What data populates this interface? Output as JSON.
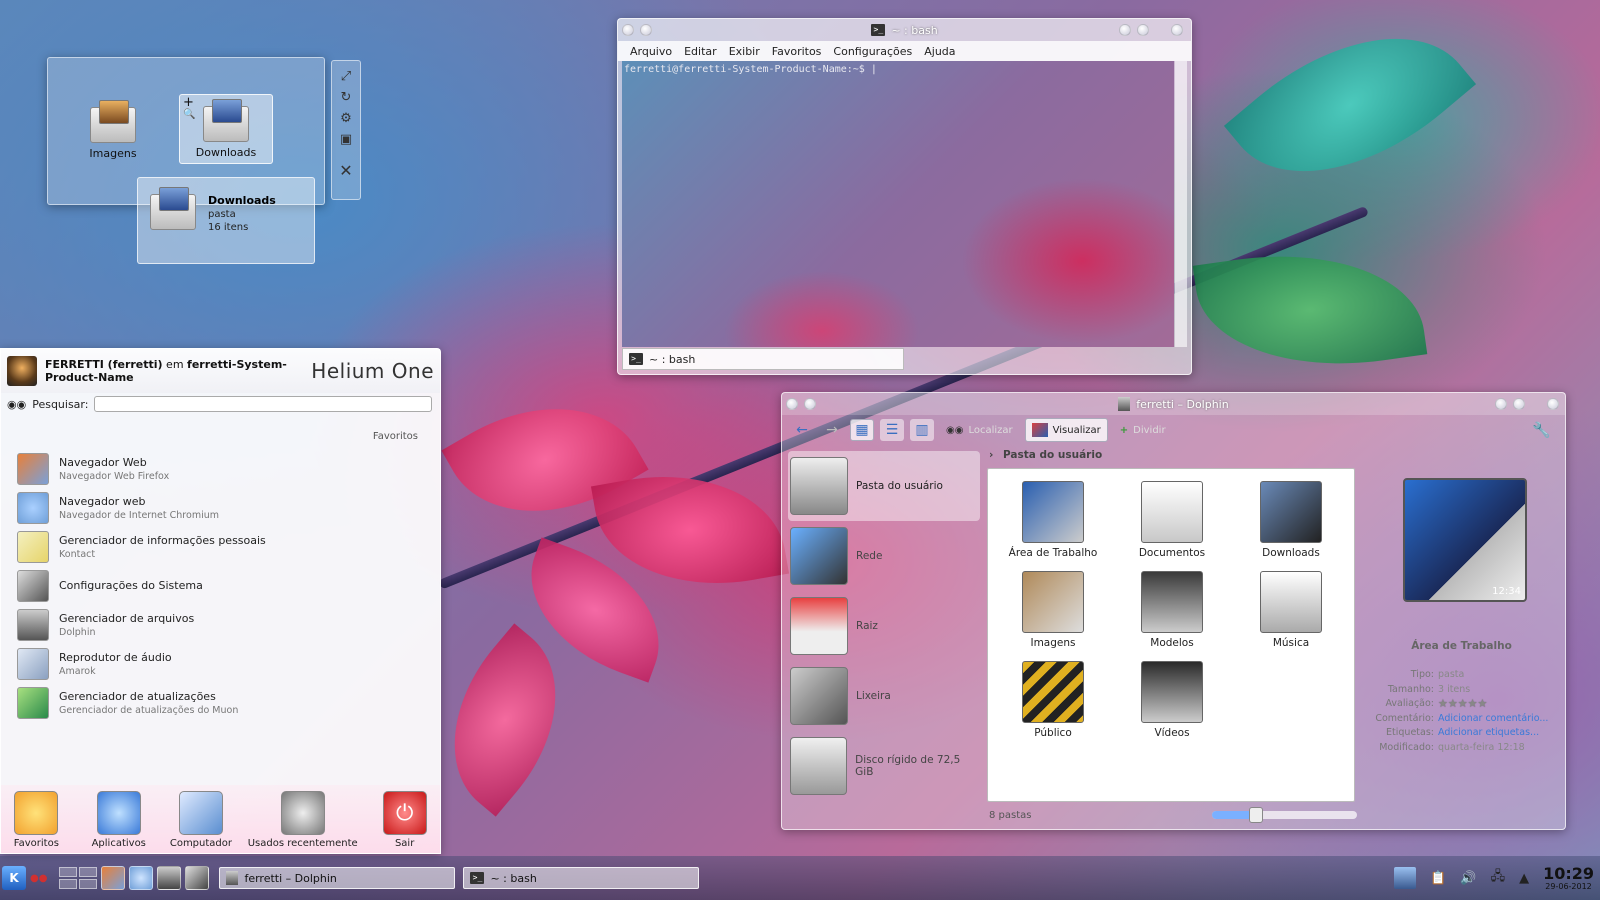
{
  "folderview": {
    "items": [
      {
        "label": "Imagens"
      },
      {
        "label": "Downloads"
      }
    ],
    "tooltip": {
      "name": "Downloads",
      "type": "pasta",
      "count": "16 itens"
    },
    "toolbar_icons": [
      "resize-icon",
      "rotate-icon",
      "settings-icon",
      "maximize-icon",
      "close-icon"
    ]
  },
  "terminal": {
    "title": "~ : bash",
    "menu": [
      "Arquivo",
      "Editar",
      "Exibir",
      "Favoritos",
      "Configurações",
      "Ajuda"
    ],
    "prompt": "ferretti@ferretti-System-Product-Name:~$ ",
    "tab_label": "~ : bash"
  },
  "launcher": {
    "user_name": "FERRETTI (ferretti)",
    "user_sep": " em ",
    "host": "ferretti-System-Product-Name",
    "brand": "Helium One",
    "search_label": "Pesquisar:",
    "search_value": "",
    "section_heading": "Favoritos",
    "apps": [
      {
        "name": "Navegador Web",
        "desc": "Navegador Web Firefox",
        "icon": "firefox-icon",
        "color": "#e8803a"
      },
      {
        "name": "Navegador web",
        "desc": "Navegador de Internet Chromium",
        "icon": "chromium-icon",
        "color": "#6f9fd8"
      },
      {
        "name": "Gerenciador de informações pessoais",
        "desc": "Kontact",
        "icon": "kontact-icon",
        "color": "#e6d46a"
      },
      {
        "name": "Configurações do Sistema",
        "desc": "",
        "icon": "settings-icon",
        "color": "#888888"
      },
      {
        "name": "Gerenciador de arquivos",
        "desc": "Dolphin",
        "icon": "dolphin-icon",
        "color": "#9a9a9a"
      },
      {
        "name": "Reprodutor de áudio",
        "desc": "Amarok",
        "icon": "amarok-icon",
        "color": "#8aa0c0"
      },
      {
        "name": "Gerenciador de atualizações",
        "desc": "Gerenciador de atualizações do Muon",
        "icon": "update-icon",
        "color": "#5db04a"
      }
    ],
    "tabs": [
      {
        "label": "Favoritos",
        "icon": "star-icon",
        "color": "#f2c12e"
      },
      {
        "label": "Aplicativos",
        "icon": "kde-icon",
        "color": "#3a7ad8"
      },
      {
        "label": "Computador",
        "icon": "computer-icon",
        "color": "#5a8ed0"
      },
      {
        "label": "Usados recentemente",
        "icon": "clock-icon",
        "color": "#9a9a9a"
      },
      {
        "label": "Sair",
        "icon": "power-icon",
        "color": "#d83030"
      }
    ]
  },
  "dolphin": {
    "title": "ferretti – Dolphin",
    "toolbar": {
      "find": "Localizar",
      "preview": "Visualizar",
      "split": "Dividir"
    },
    "places": [
      {
        "label": "Pasta do usuário",
        "icon": "home-icon"
      },
      {
        "label": "Rede",
        "icon": "network-icon"
      },
      {
        "label": "Raiz",
        "icon": "root-folder-icon"
      },
      {
        "label": "Lixeira",
        "icon": "trash-icon"
      },
      {
        "label": "Disco rígido de 72,5 GiB",
        "icon": "harddisk-icon"
      }
    ],
    "breadcrumb": "Pasta do usuário",
    "files": [
      {
        "label": "Área de Trabalho",
        "color": "#2a5fb0"
      },
      {
        "label": "Documentos",
        "color": "#c8c8c8"
      },
      {
        "label": "Downloads",
        "color": "#6a8ab8"
      },
      {
        "label": "Imagens",
        "color": "#b08a5a"
      },
      {
        "label": "Modelos",
        "color": "#3a3a3a"
      },
      {
        "label": "Música",
        "color": "#d0d0d0"
      },
      {
        "label": "Público",
        "color": "#e0b020"
      },
      {
        "label": "Vídeos",
        "color": "#2a2a2a"
      }
    ],
    "status": "8 pastas",
    "zoom_fraction": 0.3,
    "info": {
      "title": "Área de Trabalho",
      "clock": "12:34",
      "rows": [
        {
          "k": "Tipo:",
          "v": "pasta",
          "link": false
        },
        {
          "k": "Tamanho:",
          "v": "3 itens",
          "link": false
        },
        {
          "k": "Avaliação:",
          "v": "★★★★★",
          "link": false
        },
        {
          "k": "Comentário:",
          "v": "Adicionar comentário...",
          "link": true
        },
        {
          "k": "Etiquetas:",
          "v": "Adicionar etiquetas...",
          "link": true
        },
        {
          "k": "Modificado:",
          "v": "quarta-feira 12:18",
          "link": false
        }
      ]
    }
  },
  "taskbar": {
    "tasks": [
      {
        "label": "ferretti – Dolphin"
      },
      {
        "label": "~ : bash"
      }
    ],
    "clock_time": "10:29",
    "clock_date": "29-06-2012"
  }
}
